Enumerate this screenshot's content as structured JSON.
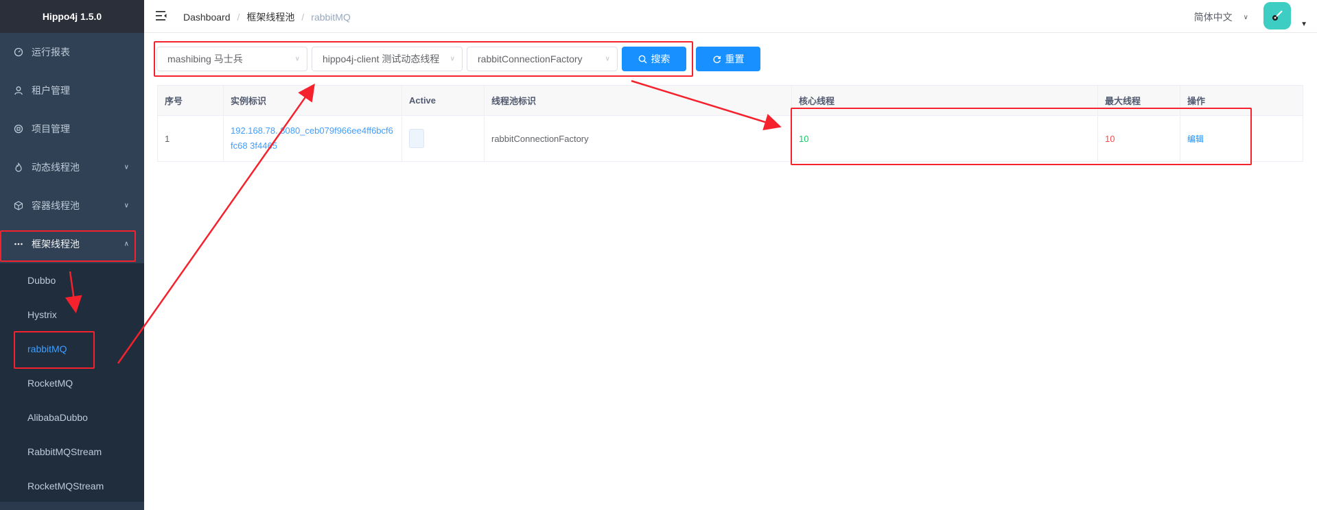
{
  "app": {
    "title": "Hippo4j 1.5.0"
  },
  "sidebar": {
    "items": [
      {
        "label": "运行报表",
        "icon": "dashboard-icon"
      },
      {
        "label": "租户管理",
        "icon": "user-icon"
      },
      {
        "label": "项目管理",
        "icon": "project-icon"
      },
      {
        "label": "动态线程池",
        "icon": "fire-icon"
      },
      {
        "label": "容器线程池",
        "icon": "box-icon"
      },
      {
        "label": "框架线程池",
        "icon": "more-icon"
      }
    ],
    "subitems": [
      "Dubbo",
      "Hystrix",
      "rabbitMQ",
      "RocketMQ",
      "AlibabaDubbo",
      "RabbitMQStream",
      "RocketMQStream"
    ],
    "active_subitem": "rabbitMQ"
  },
  "header": {
    "breadcrumb": [
      "Dashboard",
      "框架线程池",
      "rabbitMQ"
    ],
    "language": "简体中文"
  },
  "filters": {
    "tenant": "mashibing 马士兵",
    "item": "hippo4j-client 测试动态线程",
    "thread_pool": "rabbitConnectionFactory",
    "search_label": "搜索",
    "reset_label": "重置"
  },
  "table": {
    "columns": [
      "序号",
      "实例标识",
      "Active",
      "线程池标识",
      "核心线程",
      "最大线程",
      "操作"
    ],
    "rows": [
      {
        "index": "1",
        "instance": "192.168.78.  8080_ceb079f966ee4ff6bcf6fc68  3f4465",
        "pool": "rabbitConnectionFactory",
        "core": "10",
        "max": "10",
        "action": "编辑"
      }
    ]
  },
  "colors": {
    "sidebar_bg": "#304156",
    "primary": "#1890ff",
    "active_link": "#409eff",
    "core_color": "#13ce66",
    "max_color": "#ff4949",
    "annotation": "#f5222d"
  }
}
